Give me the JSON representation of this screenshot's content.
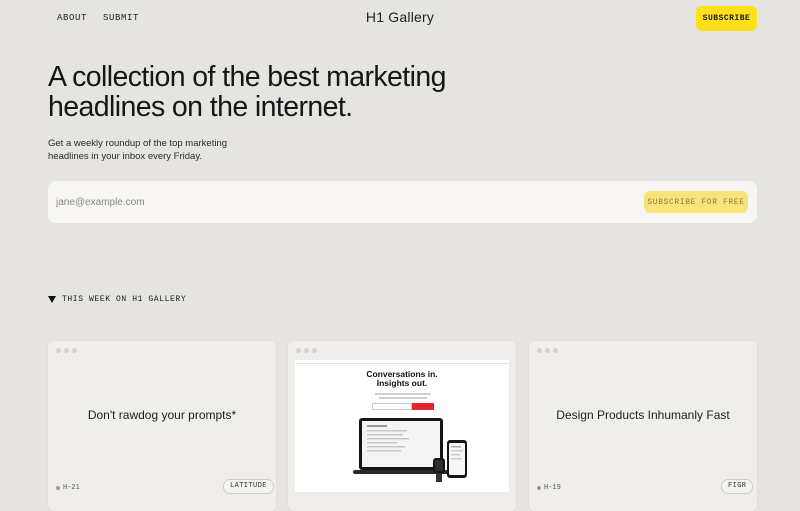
{
  "header": {
    "nav": [
      "ABOUT",
      "SUBMIT"
    ],
    "brand": "H1 Gallery",
    "subscribe_label": "SUBSCRIBE"
  },
  "hero": {
    "headline": "A collection of the best marketing headlines on the internet.",
    "tagline": "Get a weekly roundup of the top marketing headlines in your inbox every Friday."
  },
  "form": {
    "email_placeholder": "jane@example.com",
    "submit_label": "SUBSCRIBE FOR FREE"
  },
  "section": {
    "title": "THIS WEEK ON H1 GALLERY"
  },
  "cards": [
    {
      "headline": "Don't rawdog your prompts*",
      "id": "H-21",
      "tag": "LATITUDE"
    },
    {
      "screenshot_headline": "Conversations in.\nInsights out.",
      "accent": "#e0262e"
    },
    {
      "headline": "Design Products Inhumanly Fast",
      "id": "H-19",
      "tag": "FIGR"
    }
  ],
  "colors": {
    "background": "#e6e4e0",
    "accent_yellow": "#ffe01a",
    "button_muted_yellow": "#f8e47a"
  }
}
